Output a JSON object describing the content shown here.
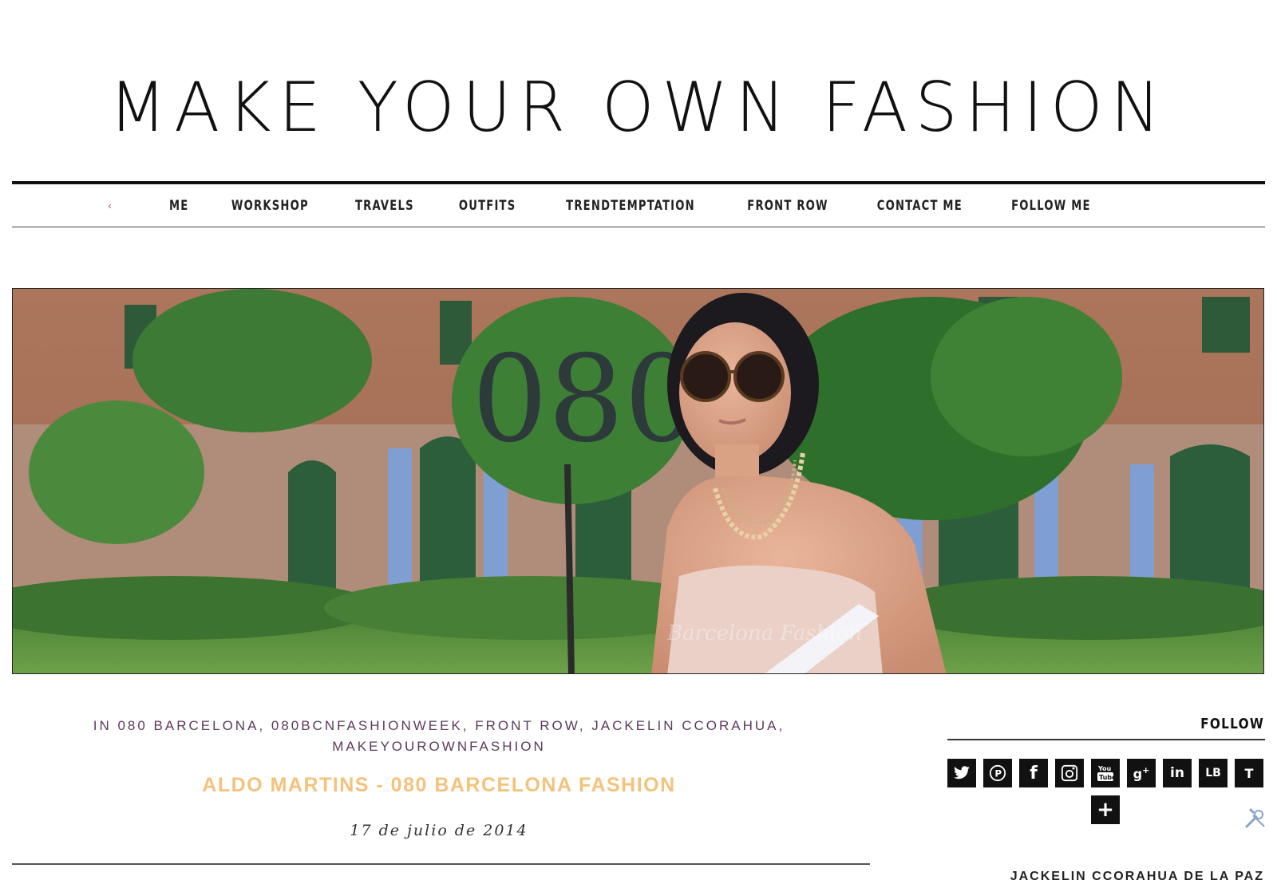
{
  "header": {
    "site_title": "MAKE YOUR OWN FASHION"
  },
  "nav": {
    "arrow_icon": "chevron-left-icon",
    "items": [
      "ME",
      "WORKSHOP",
      "TRAVELS",
      "OUTFITS",
      "TRENDTEMPTATION",
      "FRONT ROW",
      "CONTACT ME",
      "FOLLOW ME"
    ]
  },
  "hero": {
    "sign_text": "080",
    "watermark": "Barcelona Fashion"
  },
  "post": {
    "tags_line1": "IN 080 BARCELONA, 080BCNFASHIONWEEK, FRONT ROW, JACKELIN CCORAHUA,",
    "tags_line2": "MAKEYOUROWNFASHION",
    "title": "ALDO MARTINS - 080 BARCELONA FASHION",
    "date": "17 de julio de 2014"
  },
  "sidebar": {
    "follow_title": "FOLLOW",
    "social": [
      {
        "icon": "twitter-icon",
        "glyph": "🐦"
      },
      {
        "icon": "pinterest-icon",
        "glyph": "P"
      },
      {
        "icon": "facebook-icon",
        "glyph": "f"
      },
      {
        "icon": "instagram-icon",
        "glyph": "◙"
      },
      {
        "icon": "youtube-icon",
        "glyph": "▶"
      },
      {
        "icon": "google-plus-icon",
        "glyph": "g+"
      },
      {
        "icon": "linkedin-icon",
        "glyph": "in"
      },
      {
        "icon": "lookbook-icon",
        "glyph": "LB"
      },
      {
        "icon": "tumblr-icon",
        "glyph": "T"
      }
    ],
    "more_icon": "plus-icon",
    "more_glyph": "+",
    "next_widget_title": "JACKELIN CCORAHUA DE LA PAZ"
  },
  "colors": {
    "post_title": "#f3c27c",
    "tags": "#5b3a5a",
    "social_bg": "#111111"
  }
}
